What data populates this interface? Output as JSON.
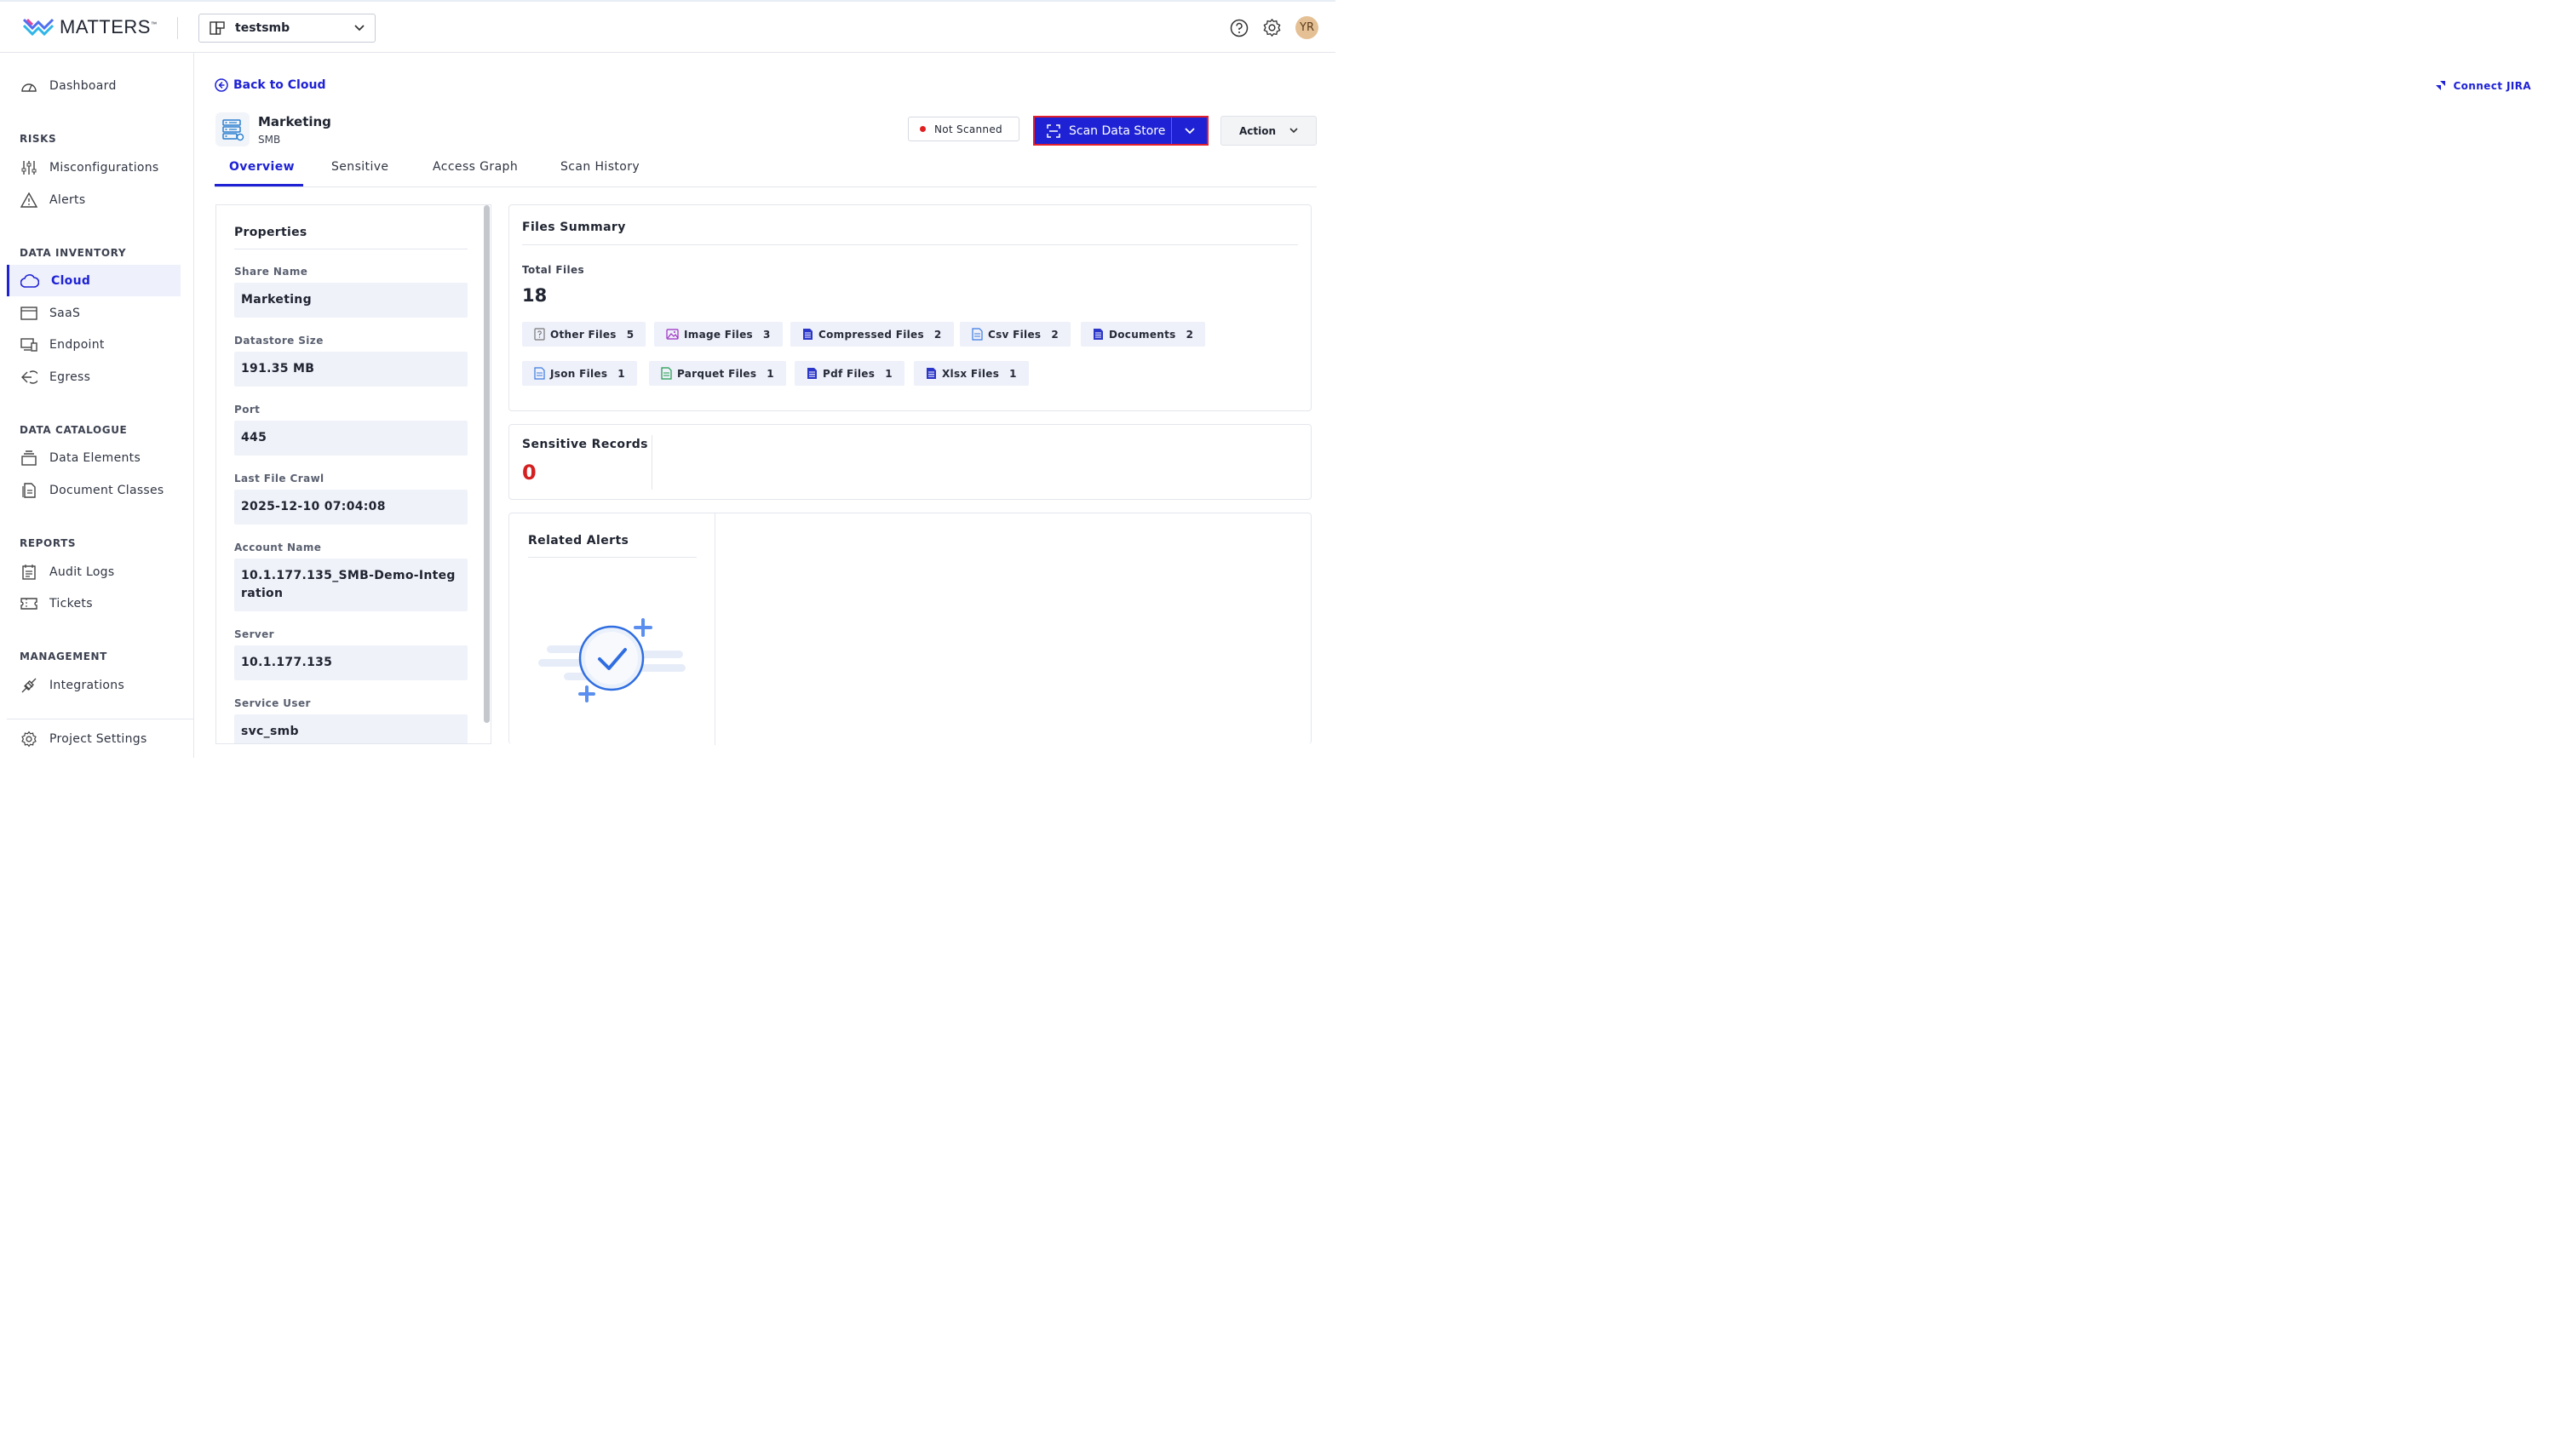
{
  "brand": {
    "name": "MATTERS",
    "tm": "™"
  },
  "header": {
    "project": "testsmb",
    "avatar_initials": "YR"
  },
  "sidebar": {
    "dashboard": "Dashboard",
    "risks_heading": "RISKS",
    "misconfigurations": "Misconfigurations",
    "alerts": "Alerts",
    "inventory_heading": "DATA INVENTORY",
    "cloud": "Cloud",
    "saas": "SaaS",
    "endpoint": "Endpoint",
    "egress": "Egress",
    "catalogue_heading": "DATA CATALOGUE",
    "data_elements": "Data Elements",
    "document_classes": "Document Classes",
    "reports_heading": "REPORTS",
    "audit_logs": "Audit Logs",
    "tickets": "Tickets",
    "management_heading": "MANAGEMENT",
    "integrations": "Integrations",
    "project_settings": "Project Settings"
  },
  "page": {
    "back_label": "Back to Cloud",
    "connect_jira": "Connect JIRA",
    "datastore_name": "Marketing",
    "datastore_type": "SMB",
    "scan_status": "Not Scanned",
    "scan_button": "Scan Data Store",
    "action_button": "Action",
    "tabs": [
      "Overview",
      "Sensitive",
      "Access Graph",
      "Scan History"
    ]
  },
  "properties": {
    "title": "Properties",
    "items": [
      {
        "label": "Share Name",
        "value": "Marketing"
      },
      {
        "label": "Datastore Size",
        "value": "191.35 MB"
      },
      {
        "label": "Port",
        "value": "445"
      },
      {
        "label": "Last File Crawl",
        "value": "2025-12-10 07:04:08"
      },
      {
        "label": "Account Name",
        "value": "10.1.177.135_SMB-Demo-Integration"
      },
      {
        "label": "Server",
        "value": "10.1.177.135"
      },
      {
        "label": "Service User",
        "value": "svc_smb"
      }
    ]
  },
  "files_summary": {
    "title": "Files Summary",
    "total_label": "Total Files",
    "total": "18",
    "chips": [
      {
        "label": "Other Files",
        "count": "5",
        "icon": "question-file-icon"
      },
      {
        "label": "Image Files",
        "count": "3",
        "icon": "image-file-icon"
      },
      {
        "label": "Compressed Files",
        "count": "2",
        "icon": "compressed-file-icon"
      },
      {
        "label": "Csv Files",
        "count": "2",
        "icon": "csv-file-icon"
      },
      {
        "label": "Documents",
        "count": "2",
        "icon": "document-file-icon"
      },
      {
        "label": "Json Files",
        "count": "1",
        "icon": "json-file-icon"
      },
      {
        "label": "Parquet Files",
        "count": "1",
        "icon": "parquet-file-icon"
      },
      {
        "label": "Pdf Files",
        "count": "1",
        "icon": "pdf-file-icon"
      },
      {
        "label": "Xlsx Files",
        "count": "1",
        "icon": "xlsx-file-icon"
      }
    ]
  },
  "sensitive_records": {
    "title": "Sensitive Records",
    "value": "0"
  },
  "related_alerts": {
    "title": "Related Alerts"
  },
  "colors": {
    "accent": "#1e22d4",
    "danger": "#d42020",
    "chip_bg": "#eef0fa"
  }
}
